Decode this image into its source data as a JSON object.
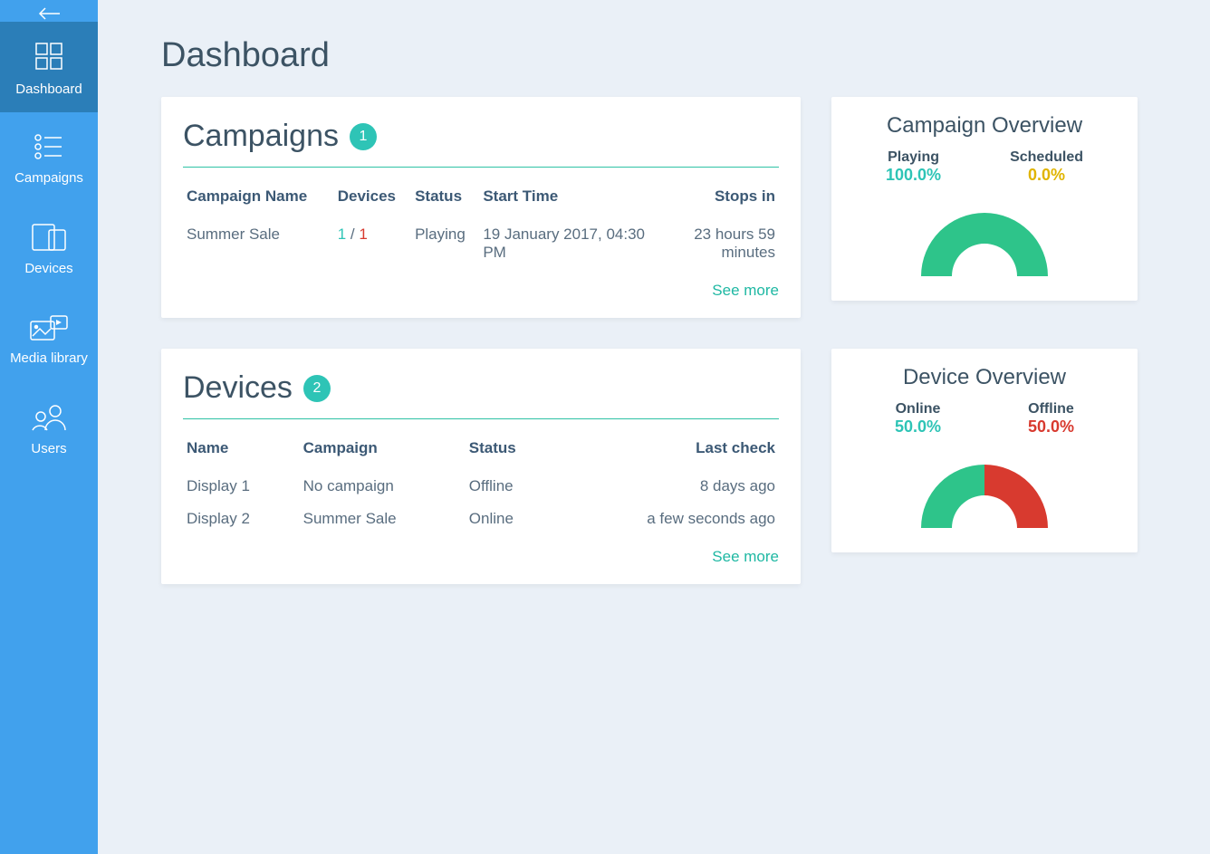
{
  "sidebar": {
    "items": [
      {
        "label": "Dashboard"
      },
      {
        "label": "Campaigns"
      },
      {
        "label": "Devices"
      },
      {
        "label": "Media library"
      },
      {
        "label": "Users"
      }
    ]
  },
  "page": {
    "title": "Dashboard"
  },
  "campaigns": {
    "title": "Campaigns",
    "count": "1",
    "columns": {
      "name": "Campaign Name",
      "devices": "Devices",
      "status": "Status",
      "start": "Start Time",
      "stops": "Stops in"
    },
    "rows": [
      {
        "name": "Summer Sale",
        "devices_online": "1",
        "devices_sep": " / ",
        "devices_total": "1",
        "status": "Playing",
        "start": "19 January 2017, 04:30 PM",
        "stops": "23 hours 59 minutes"
      }
    ],
    "see_more": "See more"
  },
  "devices": {
    "title": "Devices",
    "count": "2",
    "columns": {
      "name": "Name",
      "campaign": "Campaign",
      "status": "Status",
      "last": "Last check"
    },
    "rows": [
      {
        "name": "Display 1",
        "campaign": "No campaign",
        "status": "Offline",
        "status_class": "red",
        "last": "8 days ago"
      },
      {
        "name": "Display 2",
        "campaign": "Summer Sale",
        "status": "Online",
        "status_class": "teal",
        "last": "a few seconds ago"
      }
    ],
    "see_more": "See more"
  },
  "campaign_overview": {
    "title": "Campaign Overview",
    "left_label": "Playing",
    "left_value": "100.0%",
    "right_label": "Scheduled",
    "right_value": "0.0%"
  },
  "device_overview": {
    "title": "Device Overview",
    "left_label": "Online",
    "left_value": "50.0%",
    "right_label": "Offline",
    "right_value": "50.0%"
  },
  "chart_data": [
    {
      "type": "pie",
      "title": "Campaign Overview",
      "categories": [
        "Playing",
        "Scheduled"
      ],
      "values": [
        100.0,
        0.0
      ],
      "colors": [
        "#2ec48a",
        "#e0b400"
      ]
    },
    {
      "type": "pie",
      "title": "Device Overview",
      "categories": [
        "Online",
        "Offline"
      ],
      "values": [
        50.0,
        50.0
      ],
      "colors": [
        "#2ec48a",
        "#d83a2f"
      ]
    }
  ],
  "colors": {
    "teal": "#2ec4b6",
    "green": "#2ec48a",
    "red": "#d83a2f",
    "gold": "#e0b400",
    "accent": "#41a1ed"
  }
}
